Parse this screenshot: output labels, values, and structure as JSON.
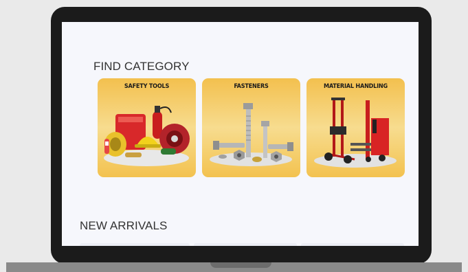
{
  "sections": {
    "find_category": "FIND CATEGORY",
    "new_arrivals": "NEW ARRIVALS"
  },
  "categories": [
    {
      "label": "SAFETY TOOLS",
      "icon": "safety-tools-image"
    },
    {
      "label": "FASTENERS",
      "icon": "fasteners-image"
    },
    {
      "label": "MATERIAL HANDLING",
      "icon": "material-handling-image"
    }
  ],
  "colors": {
    "card_gradient_top": "#f3c04e",
    "card_gradient_mid": "#f7dc8f",
    "screen_bg": "#f6f7fc",
    "device_bezel": "#1b1b1b"
  }
}
